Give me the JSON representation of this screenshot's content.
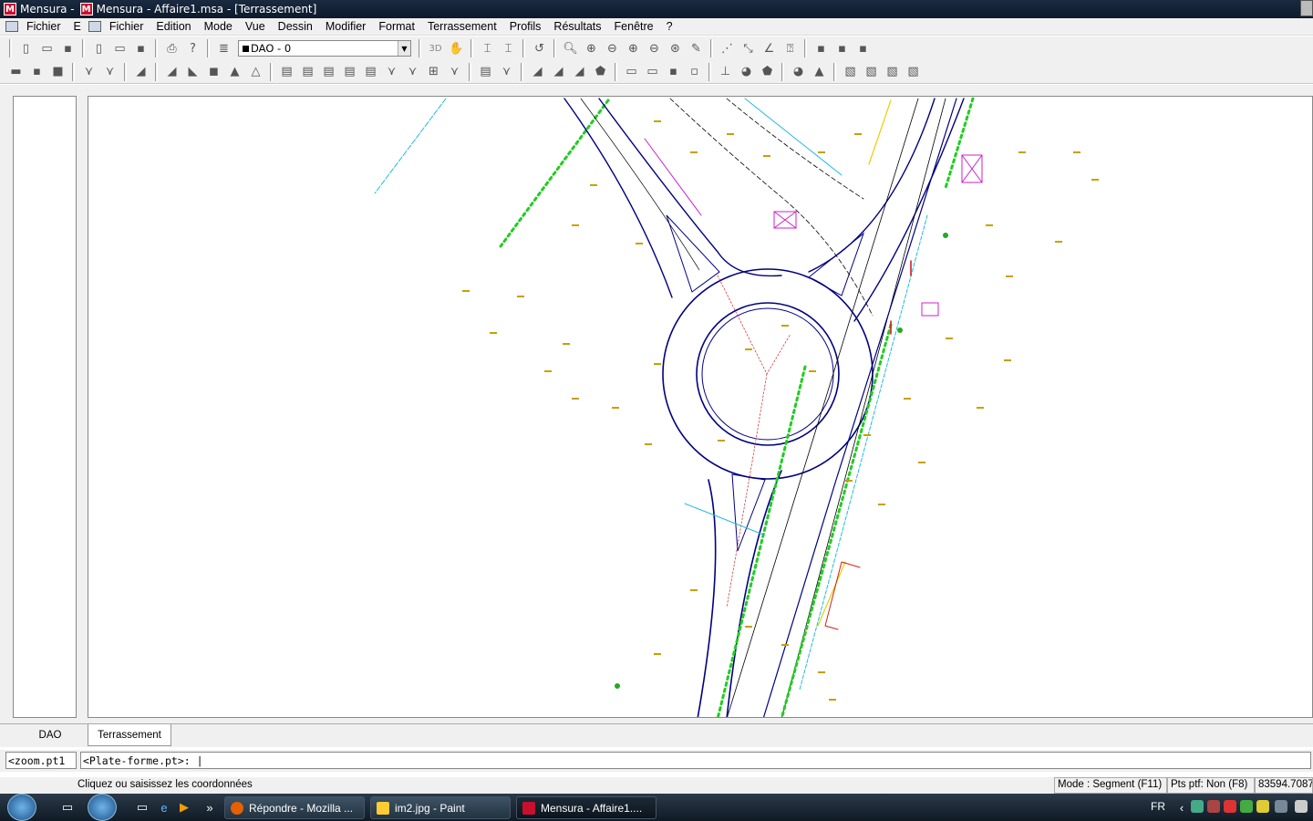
{
  "window": {
    "title": "Mensura -  Mensura - Affaire1.msa - [Terrassement]",
    "title_left": "Mensura -",
    "title_main": "Mensura - Affaire1.msa - [Terrassement]"
  },
  "menu": {
    "outer_items": [
      "Fichier",
      "E"
    ],
    "items": [
      "Fichier",
      "Edition",
      "Mode",
      "Vue",
      "Dessin",
      "Modifier",
      "Format",
      "Terrassement",
      "Profils",
      "Résultats",
      "Fenêtre",
      "?"
    ]
  },
  "toolbar": {
    "layer_value": "DAO - 0",
    "mode_3d": "3D"
  },
  "tabs": [
    "DAO",
    "Terrassement"
  ],
  "command": {
    "history": "<zoom.pt1",
    "prompt": "<Plate-forme.pt>: |"
  },
  "status": {
    "hint": "Cliquez ou saisissez les coordonnées",
    "mode": "Mode : Segment (F11)",
    "pts": "Pts ptf: Non (F8)",
    "coord": "83594.7087"
  },
  "taskbar": {
    "chevron": "»",
    "items": [
      {
        "label": "Répondre - Mozilla ...",
        "icon_color": "#e66000"
      },
      {
        "label": "im2.jpg - Paint",
        "icon_color": "#ffcc33"
      },
      {
        "label": "Mensura - Affaire1....",
        "icon_color": "#c8102e"
      }
    ],
    "lang": "FR"
  },
  "colors": {
    "road": "#000080",
    "hedge": "#22cc22",
    "cyan": "#22bbdd",
    "magenta": "#cc22cc",
    "point_label": "#c8a000"
  }
}
